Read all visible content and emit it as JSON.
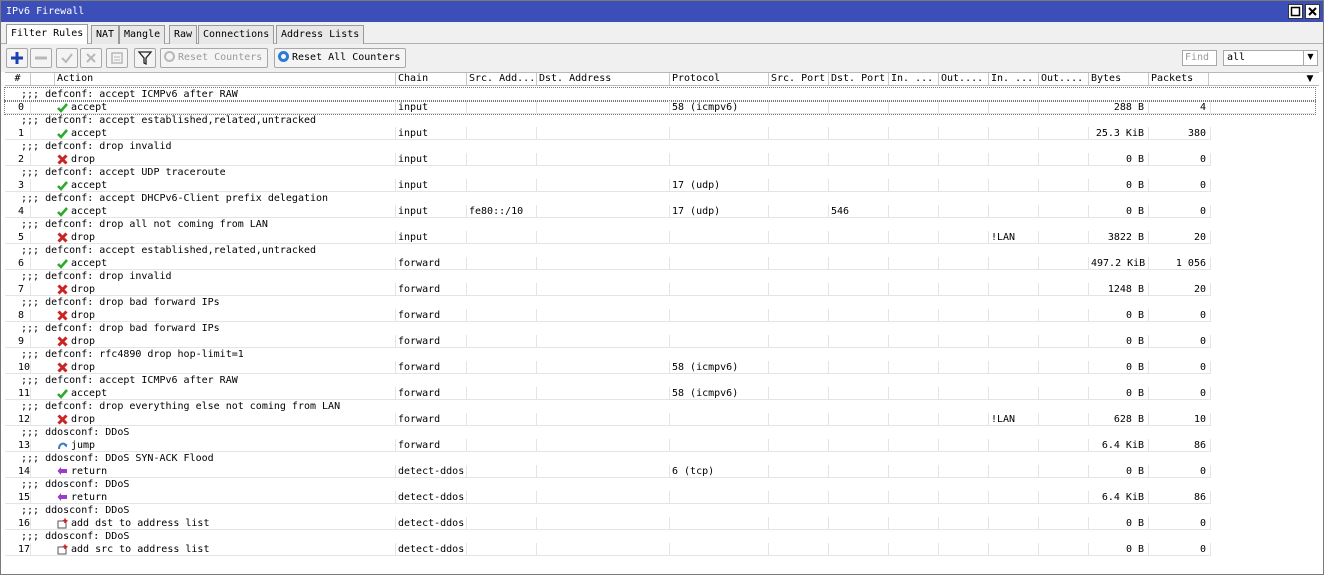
{
  "window": {
    "title": "IPv6 Firewall",
    "restore_icon": "restore-icon",
    "close_icon": "close-icon"
  },
  "tabs": [
    "Filter Rules",
    "NAT",
    "Mangle",
    "Raw",
    "Connections",
    "Address Lists"
  ],
  "active_tab": "Filter Rules",
  "toolbar": {
    "reset_counters": "Reset Counters",
    "reset_all_counters": "Reset All Counters",
    "find_placeholder": "Find",
    "filter_value": "all"
  },
  "columns": [
    "#",
    "Action",
    "Chain",
    "Src. Add...",
    "Dst. Address",
    "Protocol",
    "Src. Port",
    "Dst. Port",
    "In. ...",
    "Out....",
    "In. ...",
    "Out....",
    "Bytes",
    "Packets"
  ],
  "colors": {
    "titlebar": "#3c4fb8",
    "accept": "#2fa82f",
    "drop": "#cc2222",
    "return": "#9a3cc8",
    "jump": "#3a7ac8"
  },
  "rules": [
    {
      "comment": ";;; defconf: accept ICMPv6 after RAW",
      "num": "0",
      "action": "accept",
      "chain": "input",
      "src": "",
      "protocol": "58 (icmpv6)",
      "dst_port": "",
      "in_list": "",
      "bytes": "288 B",
      "packets": "4"
    },
    {
      "comment": ";;; defconf: accept established,related,untracked",
      "num": "1",
      "action": "accept",
      "chain": "input",
      "src": "",
      "protocol": "",
      "dst_port": "",
      "in_list": "",
      "bytes": "25.3 KiB",
      "packets": "380"
    },
    {
      "comment": ";;; defconf: drop invalid",
      "num": "2",
      "action": "drop",
      "chain": "input",
      "src": "",
      "protocol": "",
      "dst_port": "",
      "in_list": "",
      "bytes": "0 B",
      "packets": "0"
    },
    {
      "comment": ";;; defconf: accept UDP traceroute",
      "num": "3",
      "action": "accept",
      "chain": "input",
      "src": "",
      "protocol": "17 (udp)",
      "dst_port": "",
      "in_list": "",
      "bytes": "0 B",
      "packets": "0"
    },
    {
      "comment": ";;; defconf: accept DHCPv6-Client prefix delegation",
      "num": "4",
      "action": "accept",
      "chain": "input",
      "src": "fe80::/10",
      "protocol": "17 (udp)",
      "dst_port": "546",
      "in_list": "",
      "bytes": "0 B",
      "packets": "0"
    },
    {
      "comment": ";;; defconf: drop all not coming from LAN",
      "num": "5",
      "action": "drop",
      "chain": "input",
      "src": "",
      "protocol": "",
      "dst_port": "",
      "in_list": "!LAN",
      "bytes": "3822 B",
      "packets": "20"
    },
    {
      "comment": ";;; defconf: accept established,related,untracked",
      "num": "6",
      "action": "accept",
      "chain": "forward",
      "src": "",
      "protocol": "",
      "dst_port": "",
      "in_list": "",
      "bytes": "497.2 KiB",
      "packets": "1 056"
    },
    {
      "comment": ";;; defconf: drop invalid",
      "num": "7",
      "action": "drop",
      "chain": "forward",
      "src": "",
      "protocol": "",
      "dst_port": "",
      "in_list": "",
      "bytes": "1248 B",
      "packets": "20"
    },
    {
      "comment": ";;; defconf: drop bad forward IPs",
      "num": "8",
      "action": "drop",
      "chain": "forward",
      "src": "",
      "protocol": "",
      "dst_port": "",
      "in_list": "",
      "bytes": "0 B",
      "packets": "0"
    },
    {
      "comment": ";;; defconf: drop bad forward IPs",
      "num": "9",
      "action": "drop",
      "chain": "forward",
      "src": "",
      "protocol": "",
      "dst_port": "",
      "in_list": "",
      "bytes": "0 B",
      "packets": "0"
    },
    {
      "comment": ";;; defconf: rfc4890 drop hop-limit=1",
      "num": "10",
      "action": "drop",
      "chain": "forward",
      "src": "",
      "protocol": "58 (icmpv6)",
      "dst_port": "",
      "in_list": "",
      "bytes": "0 B",
      "packets": "0"
    },
    {
      "comment": ";;; defconf: accept ICMPv6 after RAW",
      "num": "11",
      "action": "accept",
      "chain": "forward",
      "src": "",
      "protocol": "58 (icmpv6)",
      "dst_port": "",
      "in_list": "",
      "bytes": "0 B",
      "packets": "0"
    },
    {
      "comment": ";;; defconf: drop everything else not coming from LAN",
      "num": "12",
      "action": "drop",
      "chain": "forward",
      "src": "",
      "protocol": "",
      "dst_port": "",
      "in_list": "!LAN",
      "bytes": "628 B",
      "packets": "10"
    },
    {
      "comment": ";;; ddosconf: DDoS",
      "num": "13",
      "action": "jump",
      "chain": "forward",
      "src": "",
      "protocol": "",
      "dst_port": "",
      "in_list": "",
      "bytes": "6.4 KiB",
      "packets": "86"
    },
    {
      "comment": ";;; ddosconf: DDoS SYN-ACK Flood",
      "num": "14",
      "action": "return",
      "chain": "detect-ddos",
      "src": "",
      "protocol": "6 (tcp)",
      "dst_port": "",
      "in_list": "",
      "bytes": "0 B",
      "packets": "0"
    },
    {
      "comment": ";;; ddosconf: DDoS",
      "num": "15",
      "action": "return",
      "chain": "detect-ddos",
      "src": "",
      "protocol": "",
      "dst_port": "",
      "in_list": "",
      "bytes": "6.4 KiB",
      "packets": "86"
    },
    {
      "comment": ";;; ddosconf: DDoS",
      "num": "16",
      "action": "add dst to address list",
      "chain": "detect-ddos",
      "src": "",
      "protocol": "",
      "dst_port": "",
      "in_list": "",
      "bytes": "0 B",
      "packets": "0"
    },
    {
      "comment": ";;; ddosconf: DDoS",
      "num": "17",
      "action": "add src to address list",
      "chain": "detect-ddos",
      "src": "",
      "protocol": "",
      "dst_port": "",
      "in_list": "",
      "bytes": "0 B",
      "packets": "0"
    }
  ]
}
